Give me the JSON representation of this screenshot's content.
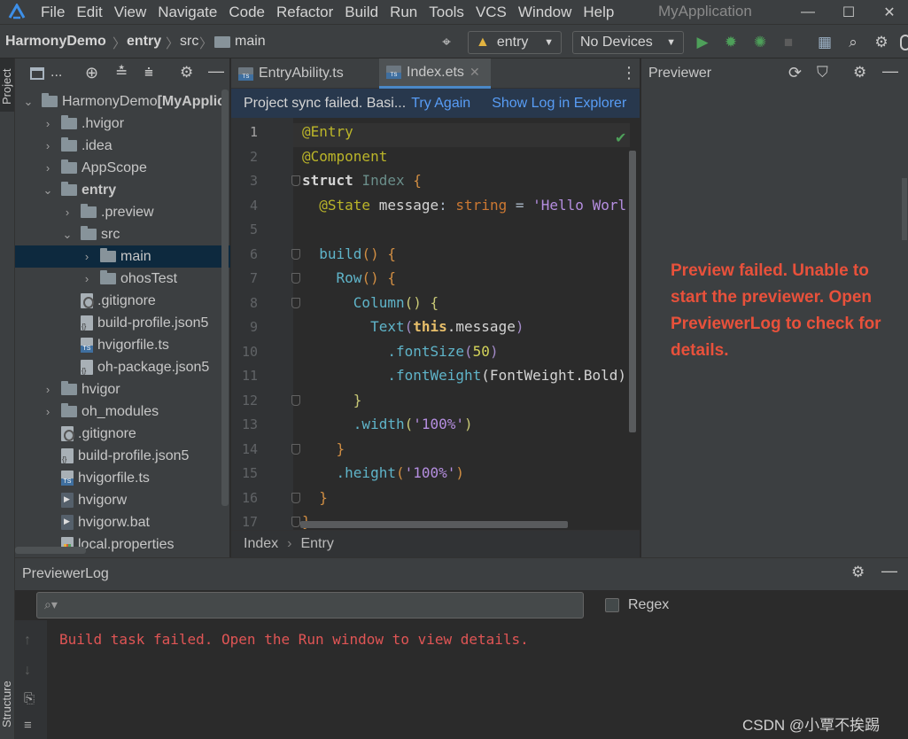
{
  "menubar": {
    "items": [
      "File",
      "Edit",
      "View",
      "Navigate",
      "Code",
      "Refactor",
      "Build",
      "Run",
      "Tools",
      "VCS",
      "Window",
      "Help"
    ],
    "app_title": "MyApplication",
    "minimize": "—",
    "maximize": "☐",
    "close": "✕"
  },
  "navbar": {
    "crumbs": [
      "HarmonyDemo",
      "entry",
      "src",
      "main"
    ],
    "module_combo": "entry",
    "device_combo": "No Devices"
  },
  "leftstrip": {
    "project_label": "Project",
    "structure_label": "Structure"
  },
  "project": {
    "header_label": "...",
    "tree": [
      {
        "label": "HarmonyDemo",
        "suffix": " [MyApplic",
        "indent": 0,
        "chev": "⌄",
        "icon": "folder"
      },
      {
        "label": ".hvigor",
        "indent": 1,
        "chev": "›",
        "icon": "folder"
      },
      {
        "label": ".idea",
        "indent": 1,
        "chev": "›",
        "icon": "folder"
      },
      {
        "label": "AppScope",
        "indent": 1,
        "chev": "›",
        "icon": "folder"
      },
      {
        "label": "entry",
        "indent": 1,
        "chev": "⌄",
        "icon": "folder",
        "bold": true
      },
      {
        "label": ".preview",
        "indent": 2,
        "chev": "›",
        "icon": "folder"
      },
      {
        "label": "src",
        "indent": 2,
        "chev": "⌄",
        "icon": "folder"
      },
      {
        "label": "main",
        "indent": 3,
        "chev": "›",
        "icon": "folder",
        "selected": true
      },
      {
        "label": "ohosTest",
        "indent": 3,
        "chev": "›",
        "icon": "folder"
      },
      {
        "label": ".gitignore",
        "indent": 2,
        "chev": "",
        "icon": "git"
      },
      {
        "label": "build-profile.json5",
        "indent": 2,
        "chev": "",
        "icon": "json"
      },
      {
        "label": "hvigorfile.ts",
        "indent": 2,
        "chev": "",
        "icon": "ts"
      },
      {
        "label": "oh-package.json5",
        "indent": 2,
        "chev": "",
        "icon": "json"
      },
      {
        "label": "hvigor",
        "indent": 1,
        "chev": "›",
        "icon": "folder"
      },
      {
        "label": "oh_modules",
        "indent": 1,
        "chev": "›",
        "icon": "folder"
      },
      {
        "label": ".gitignore",
        "indent": 1,
        "chev": "",
        "icon": "git"
      },
      {
        "label": "build-profile.json5",
        "indent": 1,
        "chev": "",
        "icon": "json"
      },
      {
        "label": "hvigorfile.ts",
        "indent": 1,
        "chev": "",
        "icon": "ts"
      },
      {
        "label": "hvigorw",
        "indent": 1,
        "chev": "",
        "icon": "exe"
      },
      {
        "label": "hvigorw.bat",
        "indent": 1,
        "chev": "",
        "icon": "exe"
      },
      {
        "label": "local.properties",
        "indent": 1,
        "chev": "",
        "icon": "props"
      }
    ]
  },
  "editor": {
    "tabs": [
      {
        "label": "EntryAbility.ts",
        "active": false
      },
      {
        "label": "Index.ets",
        "active": true
      }
    ],
    "sync_message": "Project sync failed. Basi...",
    "try_again": "Try Again",
    "show_log": "Show Log in Explorer",
    "line_numbers": [
      "1",
      "2",
      "3",
      "4",
      "5",
      "6",
      "7",
      "8",
      "9",
      "10",
      "11",
      "12",
      "13",
      "14",
      "15",
      "16",
      "17"
    ],
    "breadcrumbs": [
      "Index",
      "Entry"
    ]
  },
  "code": {
    "l1_anno": "@Entry",
    "l2_anno": "@Component",
    "l3_kw": "struct",
    "l3_name": "Index",
    "l3_brace": "{",
    "l4_anno": "@State",
    "l4_var": "message",
    "l4_colon": ":",
    "l4_type": "string",
    "l4_eq": "=",
    "l4_str": "'Hello Worl",
    "l6_fn": "build",
    "l6_rest": "() {",
    "l7_fn": "Row",
    "l7_rest": "() {",
    "l8_fn": "Column",
    "l8_rest": "() {",
    "l9_fn": "Text",
    "l9_open": "(",
    "l9_this": "this",
    "l9_member": ".message",
    "l9_close": ")",
    "l10_fn": ".fontSize",
    "l10_open": "(",
    "l10_num": "50",
    "l10_close": ")",
    "l11_fn": ".fontWeight",
    "l11_arg": "(FontWeight.Bold)",
    "l12_brace": "}",
    "l13_fn": ".width",
    "l13_open": "(",
    "l13_str": "'100%'",
    "l13_close": ")",
    "l14_brace": "}",
    "l15_fn": ".height",
    "l15_open": "(",
    "l15_str": "'100%'",
    "l15_close": ")",
    "l16_brace": "}",
    "l17_brace": "}"
  },
  "previewer": {
    "title": "Previewer",
    "message": "Preview failed. Unable to start the previewer. Open PreviewerLog to check for details."
  },
  "log": {
    "title": "PreviewerLog",
    "search_placeholder": "",
    "regex_label": "Regex",
    "error_text": "Build task failed. Open the Run window to view details."
  },
  "watermark": "CSDN @小覃不挨踢",
  "colors": {
    "accent": "#4a88c7",
    "error": "#e8513b",
    "run_green": "#4ea05a"
  }
}
